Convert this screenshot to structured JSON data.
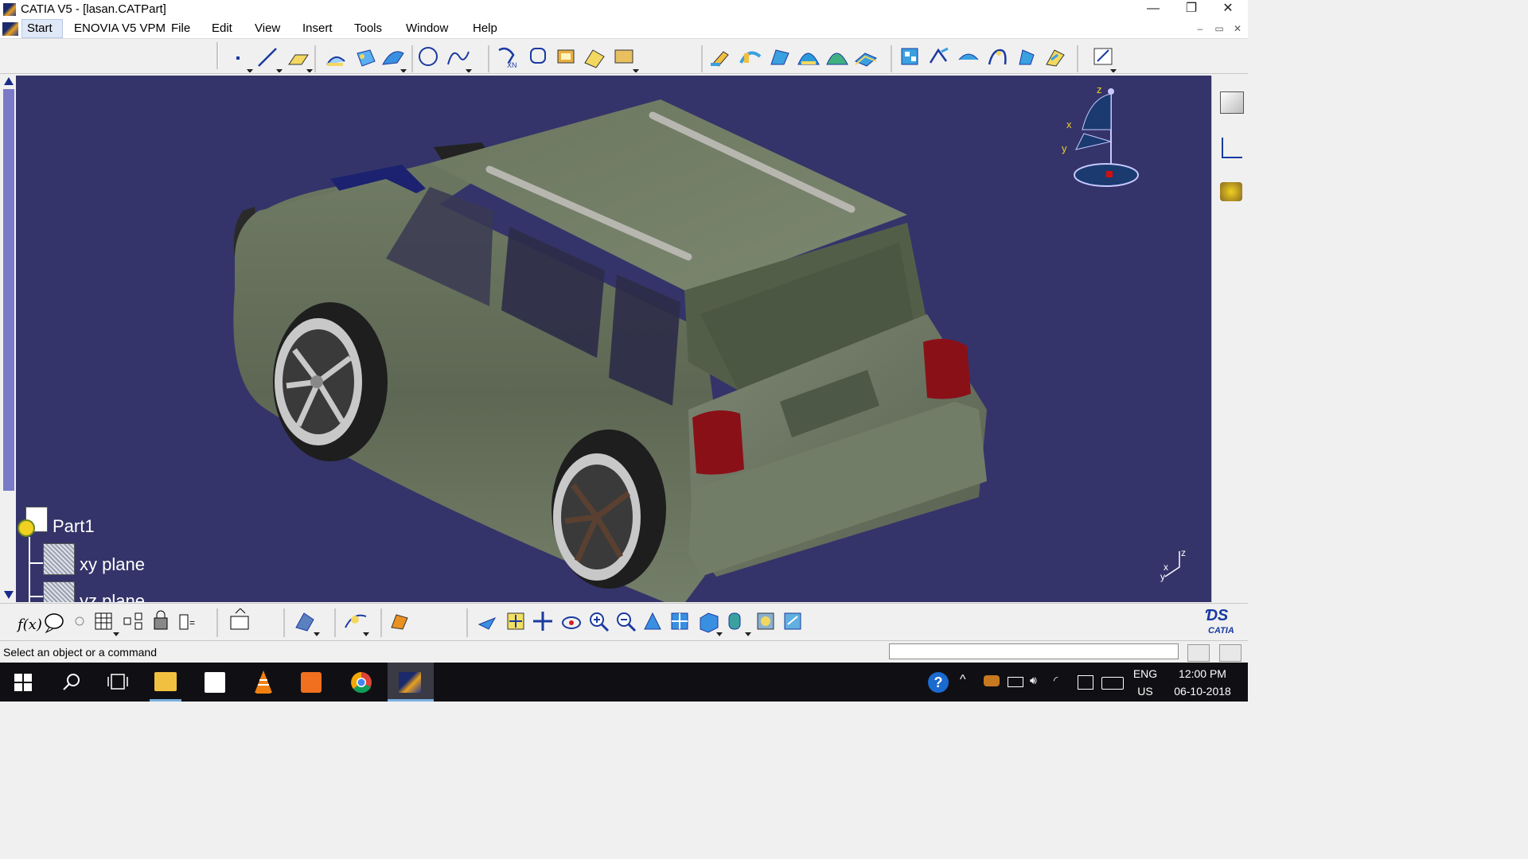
{
  "window": {
    "title": "CATIA V5 - [lasan.CATPart]",
    "minimize": "—",
    "restore": "❐",
    "close": "✕"
  },
  "menu": {
    "items": [
      {
        "label": "Start"
      },
      {
        "label": "ENOVIA V5 VPM"
      },
      {
        "label": "File"
      },
      {
        "label": "Edit"
      },
      {
        "label": "View"
      },
      {
        "label": "Insert"
      },
      {
        "label": "Tools"
      },
      {
        "label": "Window"
      },
      {
        "label": "Help"
      }
    ],
    "mdi_min": "–",
    "mdi_restore": "▭",
    "mdi_close": "✕"
  },
  "spec_tree": {
    "root": "Part1",
    "children": [
      "xy plane",
      "yz plane"
    ]
  },
  "compass": {
    "x": "x",
    "y": "y",
    "z": "z"
  },
  "mini_axis": {
    "x": "x",
    "y": "y",
    "z": "z"
  },
  "status": {
    "message": "Select an object or a command",
    "command_input": ""
  },
  "catia_logo": {
    "text": "CATIA"
  },
  "taskbar": {
    "lang_top": "ENG",
    "lang_bottom": "US",
    "time": "12:00 PM",
    "date": "06-10-2018"
  },
  "colors": {
    "viewport_bg": "#34346a",
    "body": "#6f7a64",
    "taillight": "#8a1018",
    "scroll_thumb": "#7a7ac8"
  },
  "toolbar_top_icons": [
    "point-icon",
    "line-icon",
    "plane-icon",
    "extrude-surface-icon",
    "revolve-surface-icon",
    "sweep-icon",
    "circle-icon",
    "spline-icon",
    "transform-icon",
    "curve-connect-icon",
    "join-icon",
    "healing-icon",
    "extract-icon",
    "pad-icon",
    "shaft-icon",
    "rib-icon",
    "loft-icon",
    "pocket-icon",
    "thickness-icon",
    "fillet-icon",
    "chamfer-icon",
    "draft-icon",
    "shell-icon",
    "split-icon",
    "thick-surface-icon",
    "sketcher-icon"
  ],
  "toolbar_bottom_icons": [
    "formula-icon",
    "comment-icon",
    "knowledge-icon",
    "table-icon",
    "relations-icon",
    "lock-icon",
    "parameters-icon",
    "update-icon",
    "measure-icon",
    "analysis-icon",
    "apply-material-icon",
    "fly-icon",
    "fit-all-icon",
    "pan-icon",
    "rotate-icon",
    "zoom-in-icon",
    "zoom-out-icon",
    "normal-view-icon",
    "multi-view-icon",
    "iso-view-icon",
    "hide-show-icon",
    "swap-space-icon",
    "render-style-icon"
  ],
  "right_toolbar_icons": [
    "render-style-icon",
    "graph-icon",
    "lighting-icon"
  ]
}
